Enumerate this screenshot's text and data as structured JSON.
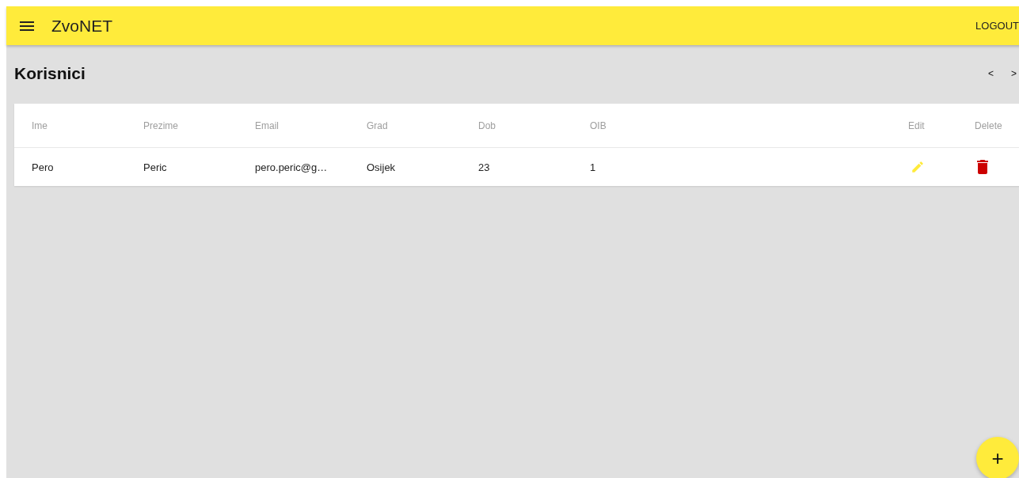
{
  "app_bar": {
    "title": "ZvoNET",
    "action": "LOGOUT"
  },
  "page": {
    "title": "Korisnici",
    "pager": [
      "<",
      ">"
    ]
  },
  "table": {
    "columns": [
      {
        "label": "Ime",
        "kind": "text"
      },
      {
        "label": "Prezime",
        "kind": "text"
      },
      {
        "label": "Email",
        "kind": "text"
      },
      {
        "label": "Grad",
        "kind": "text"
      },
      {
        "label": "Dob",
        "kind": "text"
      },
      {
        "label": "OIB",
        "kind": "text"
      },
      {
        "label": "Edit",
        "kind": "edit"
      },
      {
        "label": "Delete",
        "kind": "delete"
      }
    ],
    "rows": [
      {
        "cells": [
          "Pero",
          "Peric",
          "pero.peric@g…",
          "Osijek",
          "23",
          "1"
        ]
      }
    ]
  },
  "fab": {
    "label": "+"
  }
}
